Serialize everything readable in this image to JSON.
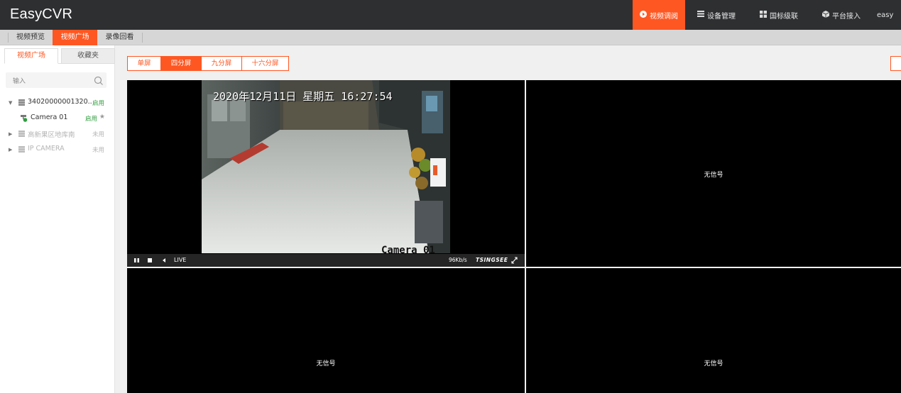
{
  "app": {
    "title": "EasyCVR"
  },
  "nav": {
    "items": [
      {
        "label": "视频调阅",
        "icon": "play-circle-icon",
        "active": true
      },
      {
        "label": "设备管理",
        "icon": "list-icon",
        "active": false
      },
      {
        "label": "国标级联",
        "icon": "grid-icon",
        "active": false
      },
      {
        "label": "平台接入",
        "icon": "cube-icon",
        "active": false
      },
      {
        "label": "easy",
        "icon": "",
        "active": false
      }
    ]
  },
  "tabs": [
    {
      "label": "视频预览",
      "active": false
    },
    {
      "label": "视频广场",
      "active": true
    },
    {
      "label": "录像回看",
      "active": false
    }
  ],
  "sidebar": {
    "tabs": [
      {
        "label": "视频广场",
        "active": true
      },
      {
        "label": "收藏夹",
        "active": false
      }
    ],
    "search": {
      "placeholder": "输入"
    },
    "tree": [
      {
        "label": "34020000001320...",
        "status": "启用",
        "enabled": true,
        "expanded": true,
        "children": [
          {
            "label": "Camera 01",
            "status": "启用",
            "starred": true
          }
        ]
      },
      {
        "label": "高新果区地库南",
        "status": "未用",
        "enabled": false,
        "expanded": false
      },
      {
        "label": "IP CAMERA",
        "status": "未用",
        "enabled": false,
        "expanded": false
      }
    ]
  },
  "splits": [
    {
      "label": "单屏",
      "active": false
    },
    {
      "label": "四分屏",
      "active": true
    },
    {
      "label": "九分屏",
      "active": false
    },
    {
      "label": "十六分屏",
      "active": false
    }
  ],
  "player": {
    "timestamp": "2020年12月11日 星期五 16:27:54",
    "camera_label": "Camera 01",
    "live_label": "LIVE",
    "bitrate": "96Kb/s",
    "brand": "TSINGSEE"
  },
  "no_signal": "无信号",
  "colors": {
    "accent": "#ff5722",
    "topbar": "#2d2f31",
    "enabled": "#2e9d3e"
  }
}
